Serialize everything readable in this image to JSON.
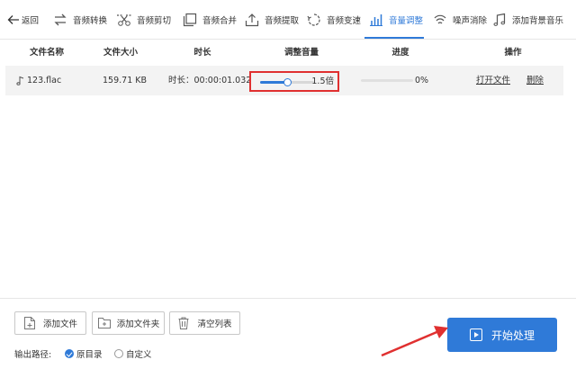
{
  "toolbar": {
    "back_label": "返回",
    "items": [
      {
        "label": "音频转换",
        "icon": "convert-icon"
      },
      {
        "label": "音频剪切",
        "icon": "scissors-icon"
      },
      {
        "label": "音频合并",
        "icon": "merge-icon"
      },
      {
        "label": "音频提取",
        "icon": "upload-icon"
      },
      {
        "label": "音频变速",
        "icon": "speed-icon"
      },
      {
        "label": "音量调整",
        "icon": "volume-bars-icon"
      },
      {
        "label": "噪声消除",
        "icon": "noise-icon"
      },
      {
        "label": "添加背景音乐",
        "icon": "music-note-icon"
      }
    ],
    "active_index": 5,
    "accent_color": "#2f7ad8"
  },
  "table": {
    "headers": [
      "文件名称",
      "文件大小",
      "时长",
      "调整音量",
      "进度",
      "操作"
    ],
    "rows": [
      {
        "name": "123.flac",
        "size": "159.71 KB",
        "duration": "时长：00:00:01.032",
        "volume_value": "1.5倍",
        "volume_level": 0.5,
        "progress_label": "0%",
        "progress": 0,
        "open_label": "打开文件",
        "delete_label": "删除"
      }
    ]
  },
  "bottom": {
    "add_file_label": "添加文件",
    "add_folder_label": "添加文件夹",
    "clear_label": "清空列表",
    "start_label": "开始处理",
    "output_label": "输出路径:",
    "output_options": [
      {
        "label": "原目录",
        "checked": true
      },
      {
        "label": "自定义",
        "checked": false
      }
    ]
  },
  "highlight_color": "#e03030"
}
